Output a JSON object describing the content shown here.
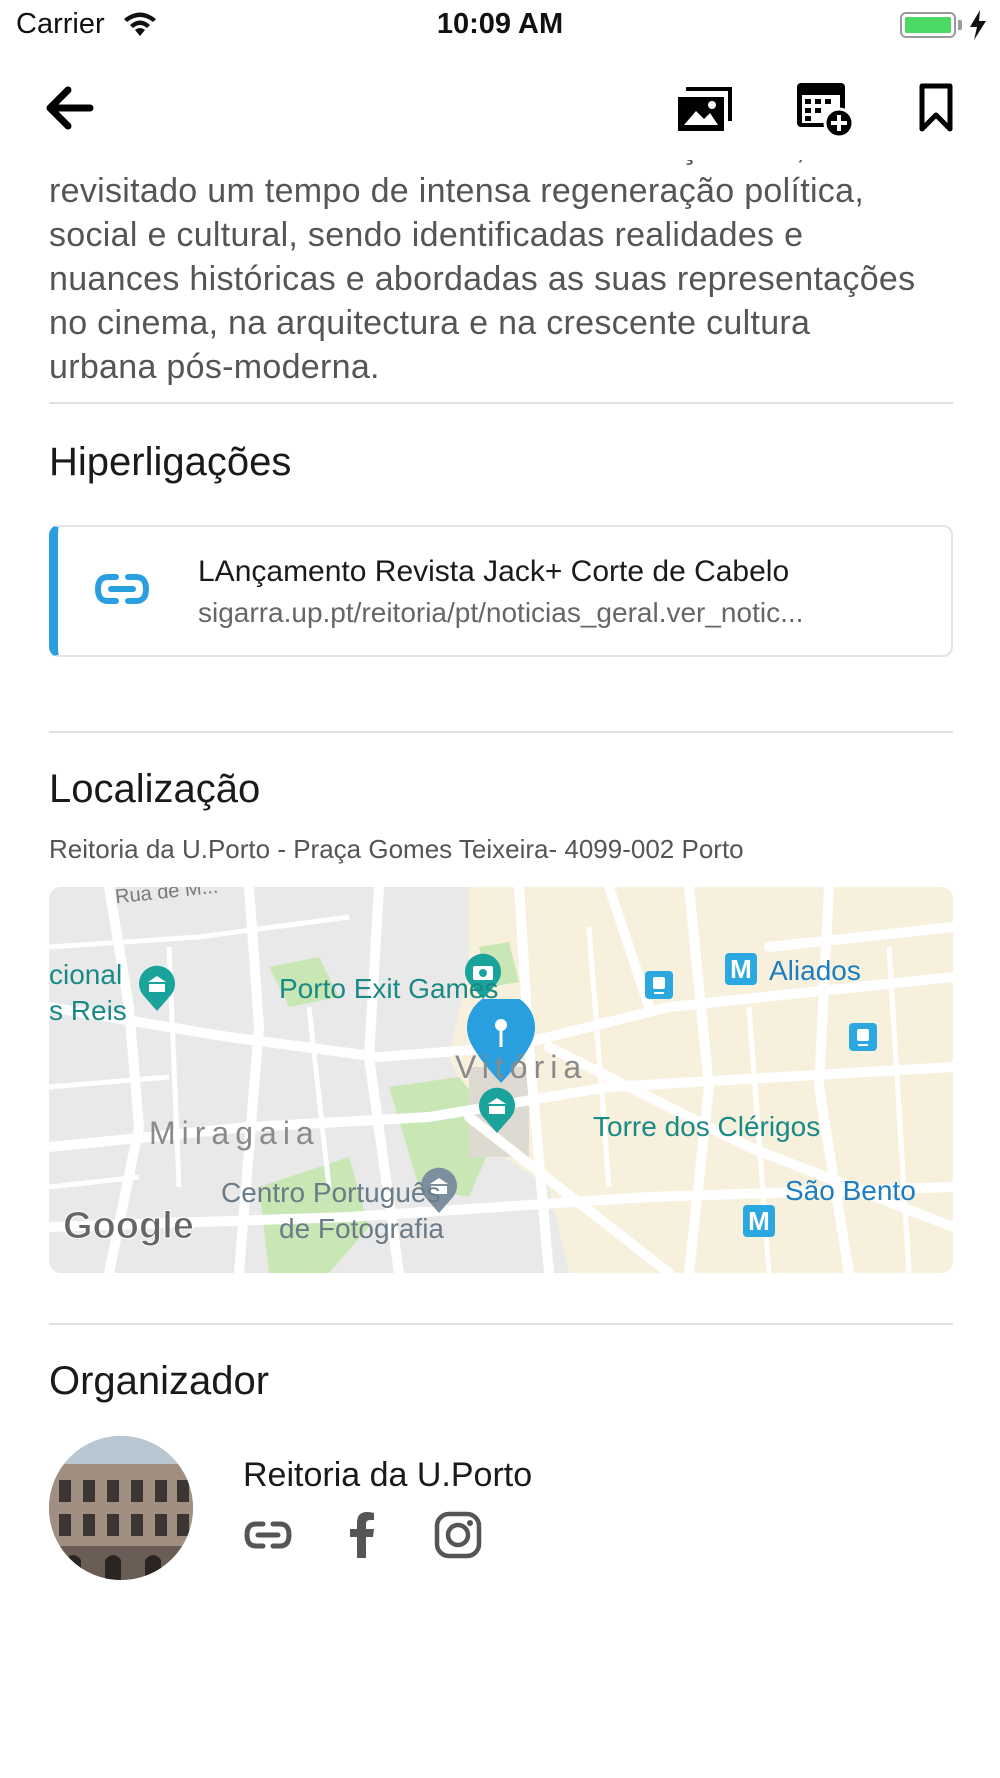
{
  "status_bar": {
    "carrier": "Carrier",
    "time": "10:09 AM",
    "battery_color": "#4cd964"
  },
  "nav": {
    "back_icon": "arrow-left-icon",
    "actions": [
      "gallery-icon",
      "calendar-add-icon",
      "bookmark-icon"
    ]
  },
  "description": {
    "lines": [
      "Cabelo como na entrevista a Manuel Graça Dias, é",
      "revisitado um tempo de intensa regeneração política,",
      "social e cultural, sendo identificadas realidades e",
      "nuances históricas e abordadas as suas representações",
      "no cinema, na arquitectura e na crescente cultura",
      "urbana pós-moderna."
    ]
  },
  "links_section": {
    "title": "Hiperligações",
    "accent_color": "#2a9fe0",
    "items": [
      {
        "title": "LAnçamento Revista Jack+ Corte de Cabelo",
        "url": "sigarra.up.pt/reitoria/pt/noticias_geral.ver_notic..."
      }
    ]
  },
  "location_section": {
    "title": "Localização",
    "address": "Reitoria da U.Porto - Praça Gomes Teixeira- 4099-002 Porto",
    "map": {
      "labels": {
        "street": "Rua de M...",
        "nacional_1": "cional",
        "nacional_2": "s Reis",
        "exit_games": "Porto Exit Games",
        "aliados": "Aliados",
        "vitoria": "Vitória",
        "miragaia": "Miragaia",
        "clerigos": "Torre dos Clérigos",
        "cpf_1": "Centro Português",
        "cpf_2": "de Fotografia",
        "sao_bento": "São Bento",
        "google": "Google",
        "metro": "M"
      },
      "pin_color": "#2a9fe0"
    }
  },
  "organizer_section": {
    "title": "Organizador",
    "name": "Reitoria da U.Porto",
    "social_icons": [
      "link-icon",
      "facebook-icon",
      "instagram-icon"
    ]
  }
}
